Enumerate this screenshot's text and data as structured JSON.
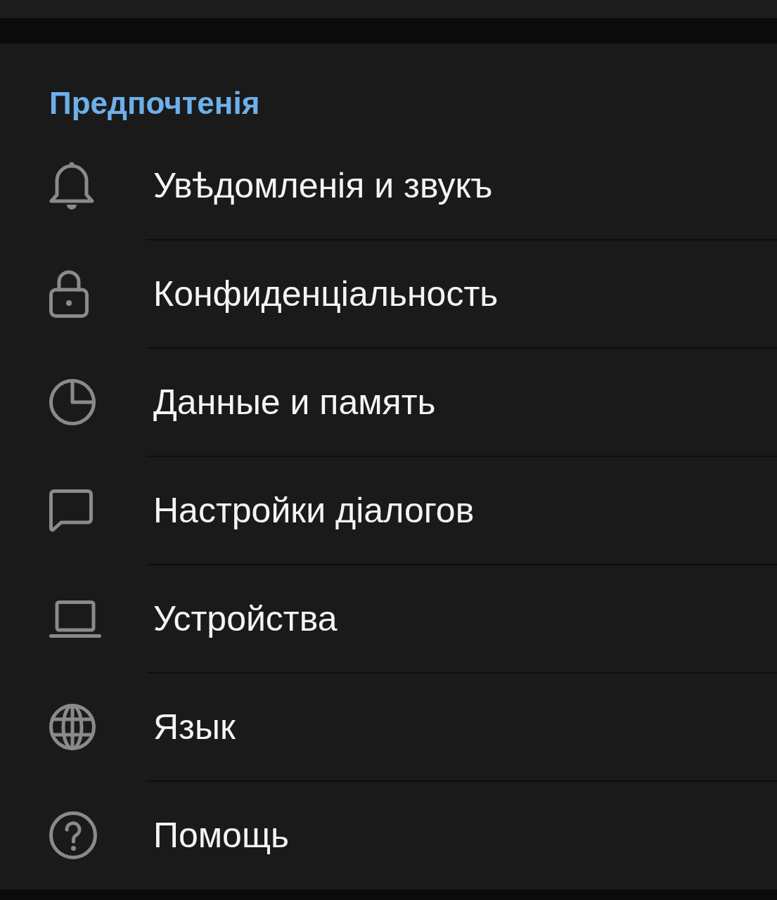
{
  "section": {
    "title": "Предпочтенія"
  },
  "items": [
    {
      "label": "Увѣдомленія и звукъ"
    },
    {
      "label": "Конфиденціальность"
    },
    {
      "label": "Данные и память"
    },
    {
      "label": "Настройки діалогов"
    },
    {
      "label": "Устройства"
    },
    {
      "label": "Язык"
    },
    {
      "label": "Помощь"
    }
  ]
}
